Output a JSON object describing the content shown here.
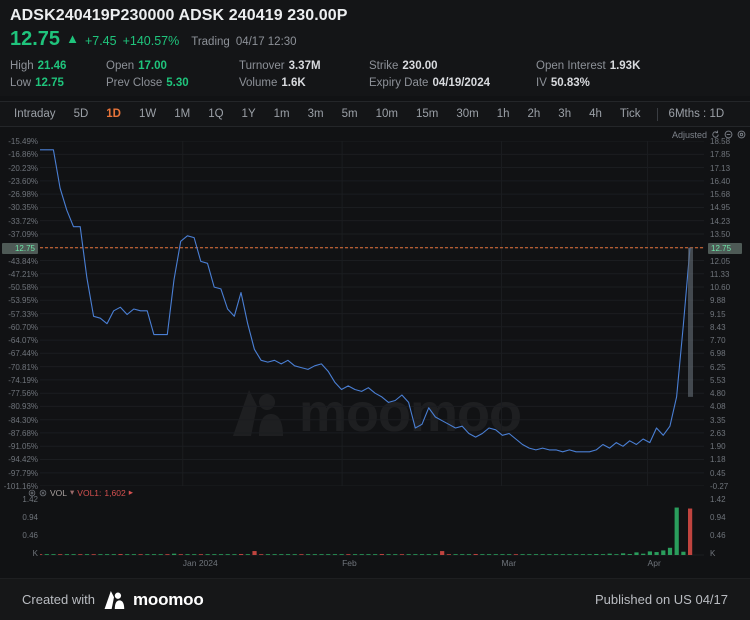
{
  "header": {
    "symbol_title": "ADSK240419P230000 ADSK 240419 230.00P",
    "last_price": "12.75",
    "arrow": "▲",
    "change": "+7.45",
    "change_pct": "+140.57%",
    "trading_state": "Trading",
    "trading_time": "04/17 12:30",
    "colors": {
      "up": "#1fc47c",
      "down": "#d4504f",
      "accent": "#e8743a",
      "line": "#4a7fd4"
    },
    "stats": [
      {
        "label": "High",
        "value": "21.46",
        "positive": true
      },
      {
        "label": "Open",
        "value": "17.00",
        "positive": true
      },
      {
        "label": "Turnover",
        "value": "3.37M",
        "positive": false
      },
      {
        "label": "Strike",
        "value": "230.00",
        "positive": false
      },
      {
        "label": "Open Interest",
        "value": "1.93K",
        "positive": false
      },
      {
        "label": "Low",
        "value": "12.75",
        "positive": true
      },
      {
        "label": "Prev Close",
        "value": "5.30",
        "positive": true
      },
      {
        "label": "Volume",
        "value": "1.6K",
        "positive": false
      },
      {
        "label": "Expiry Date",
        "value": "04/19/2024",
        "positive": false
      },
      {
        "label": "IV",
        "value": "50.83%",
        "positive": false
      }
    ]
  },
  "tabs": {
    "items": [
      {
        "label": "Intraday",
        "active": false
      },
      {
        "label": "5D",
        "active": false
      },
      {
        "label": "1D",
        "active": true
      },
      {
        "label": "1W",
        "active": false
      },
      {
        "label": "1M",
        "active": false
      },
      {
        "label": "1Q",
        "active": false
      },
      {
        "label": "1Y",
        "active": false
      },
      {
        "label": "1m",
        "active": false
      },
      {
        "label": "3m",
        "active": false
      },
      {
        "label": "5m",
        "active": false
      },
      {
        "label": "10m",
        "active": false
      },
      {
        "label": "15m",
        "active": false
      },
      {
        "label": "30m",
        "active": false
      },
      {
        "label": "1h",
        "active": false
      },
      {
        "label": "2h",
        "active": false
      },
      {
        "label": "3h",
        "active": false
      },
      {
        "label": "4h",
        "active": false
      },
      {
        "label": "Tick",
        "active": false
      }
    ],
    "range_label": "6Mths : 1D"
  },
  "chart_toolbar": {
    "adjusted_label": "Adjusted",
    "icons": [
      "refresh-icon",
      "zoom-out-icon",
      "settings-icon"
    ]
  },
  "volume_indicator": {
    "label": "VOL",
    "series_label": "VOL1:",
    "series_value": "1,602"
  },
  "footer": {
    "created_with": "Created with",
    "brand": "moomoo",
    "published": "Published on US 04/17"
  },
  "watermark": {
    "text": "moomoo"
  },
  "chart_data": {
    "type": "line",
    "title": "ADSK240419P230000 ADSK 240419 230.00P",
    "xlabel": "",
    "ylabel": "Price",
    "legend_position": "none",
    "grid": true,
    "x_tick_labels": [
      "Jan 2024",
      "Feb",
      "Mar",
      "Apr"
    ],
    "x_tick_positions_pct": [
      21.5,
      45.5,
      69.5,
      91.5
    ],
    "price_axis": {
      "side": "right",
      "ticks": [
        18.58,
        17.85,
        17.13,
        16.4,
        15.68,
        14.95,
        14.23,
        13.5,
        12.75,
        12.05,
        11.33,
        10.6,
        9.88,
        9.15,
        8.43,
        7.7,
        6.98,
        6.25,
        5.53,
        4.8,
        4.08,
        3.35,
        2.63,
        1.9,
        1.18,
        0.45,
        -0.27
      ],
      "ylim": [
        -0.27,
        18.58
      ]
    },
    "percent_axis": {
      "side": "left",
      "ticks": [
        "-15.49%",
        "-16.86%",
        "-20.23%",
        "-23.60%",
        "-26.98%",
        "-30.35%",
        "-33.72%",
        "-37.09%",
        "-43.84%",
        "-47.21%",
        "-50.58%",
        "-53.95%",
        "-57.33%",
        "-60.70%",
        "-64.07%",
        "-67.44%",
        "-70.81%",
        "-74.19%",
        "-77.56%",
        "-80.93%",
        "-84.30%",
        "-87.68%",
        "-91.05%",
        "-94.42%",
        "-97.79%",
        "-101.16%"
      ]
    },
    "current_price_line": {
      "value": 12.75,
      "label": "12.75",
      "style": "dashed",
      "color": "#e8743a"
    },
    "price_series": {
      "name": "Close",
      "color": "#4a7fd4",
      "values": [
        18.1,
        18.1,
        18.1,
        16.0,
        14.8,
        13.9,
        13.9,
        11.1,
        9.0,
        8.9,
        8.6,
        9.3,
        9.5,
        9.1,
        9.4,
        9.3,
        9.3,
        8.0,
        8.0,
        8.0,
        11.0,
        13.1,
        13.4,
        13.3,
        12.0,
        11.9,
        10.6,
        10.5,
        9.4,
        9.0,
        10.3,
        8.6,
        7.2,
        6.6,
        6.5,
        6.6,
        6.4,
        6.6,
        6.3,
        6.2,
        6.1,
        6.3,
        6.4,
        6.0,
        5.4,
        5.0,
        5.2,
        5.0,
        4.9,
        5.1,
        4.8,
        4.6,
        4.3,
        4.4,
        4.7,
        4.3,
        2.9,
        3.1,
        4.0,
        3.5,
        3.3,
        3.1,
        2.9,
        3.0,
        2.6,
        2.4,
        2.6,
        2.9,
        2.8,
        2.5,
        2.6,
        2.3,
        2.0,
        1.8,
        1.7,
        1.8,
        1.7,
        1.7,
        1.6,
        1.7,
        1.6,
        1.6,
        1.6,
        1.7,
        2.0,
        1.8,
        2.1,
        1.9,
        2.2,
        2.0,
        2.3,
        2.1,
        2.9,
        2.5,
        3.0,
        4.6,
        8.5,
        12.75
      ]
    },
    "volume_axis": {
      "ticks": [
        "1.42",
        "0.94",
        "0.46",
        "K"
      ],
      "unit": "K",
      "ylim": [
        0,
        1.65
      ]
    },
    "volume_series": {
      "name": "VOL",
      "up_color": "#2a9d5c",
      "down_color": "#c0443f",
      "values": [
        0.02,
        0,
        0,
        0.01,
        0,
        0,
        0.02,
        0,
        0.01,
        0,
        0,
        0,
        0.03,
        0,
        0,
        0.01,
        0,
        0,
        0,
        0.02,
        0.04,
        0.01,
        0,
        0,
        0.02,
        0,
        0,
        0.01,
        0,
        0,
        0.03,
        0,
        0.12,
        0.02,
        0,
        0,
        0.01,
        0,
        0,
        0.02,
        0,
        0,
        0.01,
        0,
        0,
        0,
        0.02,
        0,
        0,
        0.01,
        0,
        0.03,
        0,
        0,
        0.01,
        0,
        0,
        0.02,
        0,
        0,
        0.12,
        0.02,
        0,
        0,
        0.01,
        0.03,
        0,
        0,
        0.01,
        0,
        0,
        0.02,
        0,
        0,
        0.01,
        0,
        0.02,
        0,
        0.01,
        0,
        0.02,
        0.01,
        0,
        0.03,
        0.02,
        0.04,
        0.02,
        0.05,
        0.03,
        0.08,
        0.04,
        0.11,
        0.09,
        0.14,
        0.22,
        1.45,
        0.1,
        1.42
      ],
      "directions": [
        "down",
        "up",
        "up",
        "down",
        "up",
        "up",
        "down",
        "up",
        "down",
        "up",
        "up",
        "up",
        "down",
        "up",
        "up",
        "down",
        "up",
        "up",
        "up",
        "down",
        "up",
        "down",
        "up",
        "up",
        "down",
        "up",
        "up",
        "up",
        "up",
        "up",
        "down",
        "up",
        "down",
        "down",
        "up",
        "up",
        "up",
        "up",
        "up",
        "down",
        "up",
        "up",
        "up",
        "up",
        "up",
        "up",
        "down",
        "up",
        "up",
        "up",
        "up",
        "down",
        "up",
        "up",
        "down",
        "up",
        "up",
        "up",
        "up",
        "up",
        "down",
        "down",
        "up",
        "up",
        "up",
        "down",
        "up",
        "up",
        "up",
        "up",
        "up",
        "down",
        "up",
        "up",
        "up",
        "up",
        "up",
        "up",
        "up",
        "up",
        "up",
        "up",
        "up",
        "up",
        "up",
        "up",
        "up",
        "up",
        "up",
        "up",
        "up",
        "up",
        "up",
        "up",
        "up",
        "up",
        "up",
        "down"
      ]
    }
  }
}
